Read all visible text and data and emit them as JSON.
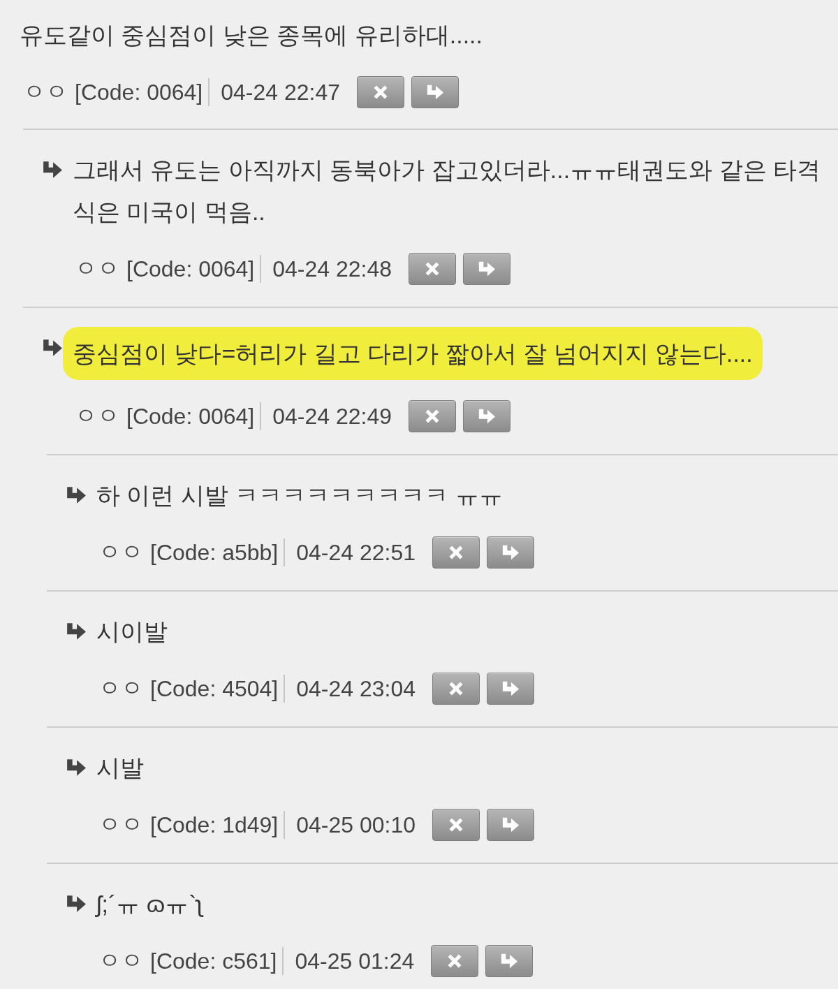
{
  "comments": [
    {
      "text": "유도같이 중심점이 낮은 종목에 유리하대.....",
      "author": "ㅇㅇ",
      "code": "[Code: 0064]",
      "time": "04-24 22:47",
      "highlighted": false,
      "children": [
        {
          "text": "그래서 유도는 아직까지 동북아가 잡고있더라...ㅠㅠ태권도와 같은 타격식은 미국이 먹음..",
          "author": "ㅇㅇ",
          "code": "[Code: 0064]",
          "time": "04-24 22:48",
          "highlighted": false
        },
        {
          "text": "중심점이 낮다=허리가 길고 다리가 짧아서 잘 넘어지지 않는다....",
          "author": "ㅇㅇ",
          "code": "[Code: 0064]",
          "time": "04-24 22:49",
          "highlighted": true,
          "children": [
            {
              "text": "하 이런 시발 ㅋㅋㅋㅋㅋㅋㅋㅋㅋ ㅠㅠ",
              "author": "ㅇㅇ",
              "code": "[Code: a5bb]",
              "time": "04-24 22:51",
              "highlighted": false
            },
            {
              "text": "시이발",
              "author": "ㅇㅇ",
              "code": "[Code: 4504]",
              "time": "04-24 23:04",
              "highlighted": false
            },
            {
              "text": "시발",
              "author": "ㅇㅇ",
              "code": "[Code: 1d49]",
              "time": "04-25 00:10",
              "highlighted": false
            },
            {
              "text": "ʃ;´ㅠ ɷㅠ`ʅ",
              "author": "ㅇㅇ",
              "code": "[Code: c561]",
              "time": "04-25 01:24",
              "highlighted": false
            }
          ]
        }
      ]
    }
  ]
}
